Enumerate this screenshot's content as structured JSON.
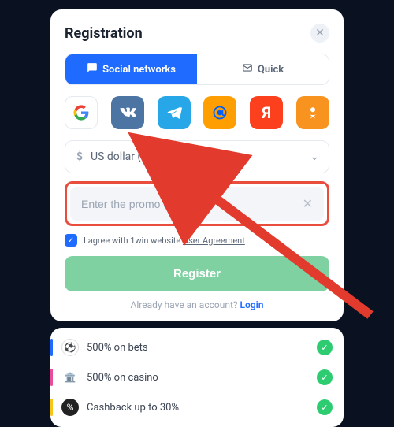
{
  "header": {
    "title": "Registration"
  },
  "tabs": {
    "social": "Social networks",
    "quick": "Quick"
  },
  "currency": {
    "label": "US dollar (USD)"
  },
  "promo": {
    "placeholder": "Enter the promo code"
  },
  "agreement": {
    "text_prefix": "I agree with 1win website ",
    "link": "User Agreement"
  },
  "buttons": {
    "register": "Register"
  },
  "login_line": {
    "prefix": "Already have an account? ",
    "action": "Login"
  },
  "bonuses": [
    {
      "label": "500% on bets"
    },
    {
      "label": "500% on casino"
    },
    {
      "label": "Cashback up to 30%"
    }
  ],
  "colors": {
    "highlight_box": "#e84d3d",
    "primary_blue": "#1f6bff",
    "register_green": "#7fd1a2"
  }
}
